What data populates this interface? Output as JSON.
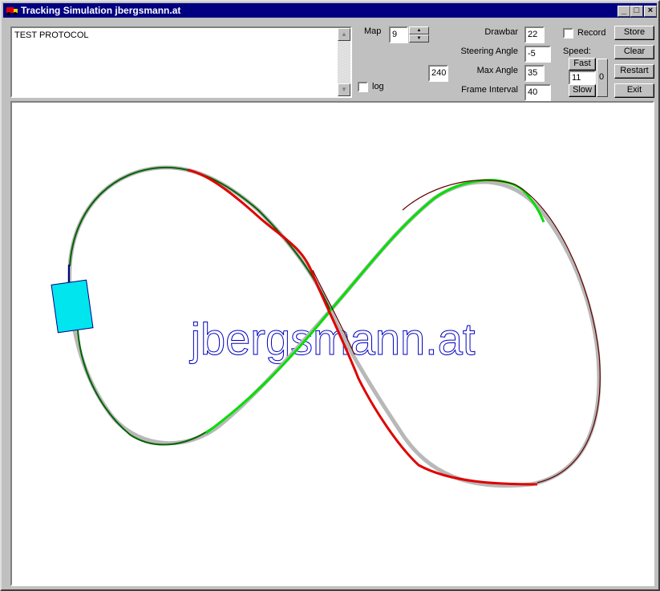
{
  "window": {
    "title": "Tracking Simulation jbergsmann.at",
    "minimize_glyph": "_",
    "maximize_glyph": "□",
    "close_glyph": "×"
  },
  "protocol": {
    "text": "TEST PROTOCOL"
  },
  "map": {
    "label": "Map",
    "value": "9"
  },
  "readout": {
    "value": "240"
  },
  "log": {
    "label": "log",
    "checked": false
  },
  "params": {
    "drawbar_label": "Drawbar",
    "drawbar_value": "22",
    "steering_label": "Steering Angle",
    "steering_value": "-5",
    "maxangle_label": "Max Angle",
    "maxangle_value": "35",
    "frame_label": "Frame Interval",
    "frame_value": "40"
  },
  "record": {
    "label": "Record",
    "checked": false
  },
  "speed": {
    "label": "Speed:",
    "fast_label": "Fast",
    "slow_label": "Slow",
    "value": "11",
    "trackbar_value": "0"
  },
  "buttons": {
    "store": "Store",
    "clear": "Clear",
    "restart": "Restart",
    "exit": "Exit"
  },
  "canvas": {
    "watermark": "jbergsmann.at",
    "colors": {
      "reference_track": "#b8b8b8",
      "path_dark_green": "#006400",
      "path_green": "#00e000",
      "path_red": "#e00000",
      "path_dark_red": "#600000",
      "vehicle_fill": "#00e5ee",
      "vehicle_stroke": "#000080",
      "watermark_stroke": "#0000c0"
    }
  }
}
